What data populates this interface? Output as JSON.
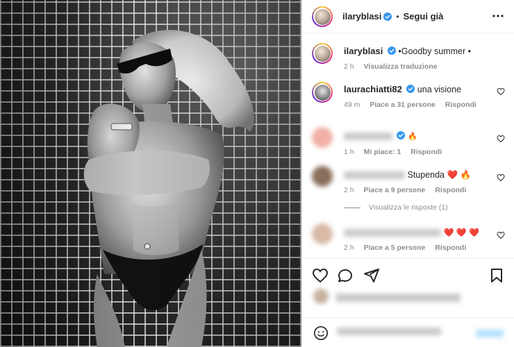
{
  "post": {
    "author": "ilaryblasi",
    "follow_label": "Segui già",
    "more_icon": "more-horizontal-icon"
  },
  "caption": {
    "username": "ilaryblasi",
    "text": "•Goodby summer •",
    "time": "2 h",
    "translate_label": "Visualizza traduzione"
  },
  "comments": [
    {
      "username": "laurachiatti82",
      "text": "una visione",
      "time": "49 m",
      "likes": "Piace a 31 persone",
      "reply": "Rispondi"
    },
    {
      "username": "",
      "text": "🔥",
      "time": "1 h",
      "likes": "Mi piace: 1",
      "reply": "Rispondi"
    },
    {
      "username": "",
      "text": "Stupenda ❤️ 🔥",
      "time": "2 h",
      "likes": "Piace a 9 persone",
      "reply": "Rispondi"
    },
    {
      "username": "",
      "text": "❤️ ❤️ ❤️",
      "time": "2 h",
      "likes": "Piace a 5 persone",
      "reply": "Rispondi"
    }
  ],
  "view_replies": "Visualizza le risposte (1)",
  "actions": {
    "like_icon": "heart-icon",
    "comment_icon": "comment-icon",
    "share_icon": "share-icon",
    "save_icon": "bookmark-icon"
  },
  "colors": {
    "verified": "#3897f0",
    "link": "#b2dffc",
    "meta_text": "#8e8e8e"
  }
}
